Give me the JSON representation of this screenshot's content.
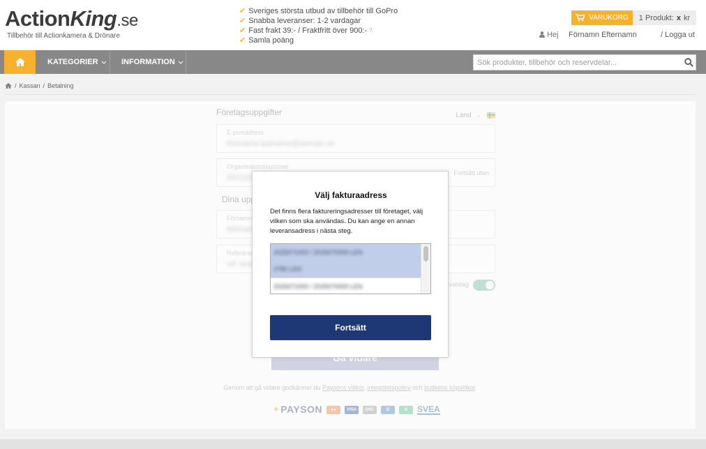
{
  "header": {
    "logo_action": "Action",
    "logo_king": "King",
    "logo_se": ".se",
    "logo_tagline": "Tillbehör till Actionkamera & Drönare",
    "usps": [
      "Sveriges största utbud av tillbehör till GoPro",
      "Snabba leveranser: 1-2 vardagar",
      "Fast frakt 39:- / Fraktfritt över 900:-",
      "Samla poäng"
    ],
    "usp_info": "?",
    "cart_label": "VARUKORG",
    "cart_count": "1 Produkt:",
    "cart_x": "x",
    "cart_currency": "kr",
    "greeting": "Hej",
    "user_name": "Förnamn Efternamn",
    "logout": "/ Logga ut"
  },
  "nav": {
    "items": [
      {
        "label": "KATEGORIER"
      },
      {
        "label": "INFORMATION"
      }
    ],
    "search_placeholder": "Sök produkter, tillbehör och reservdelar..."
  },
  "breadcrumb": {
    "items": [
      "Kassan",
      "Betalning"
    ]
  },
  "form": {
    "company_section": "Företagsuppgifter",
    "land_label": "Land",
    "email_label": "E-postadress",
    "email_value": "firstname.lastname@domain.se",
    "orgnr_label": "Organisationsnummer",
    "orgnr_value": "20211000000",
    "orgnr_side": "Fortsätt utan",
    "your_section": "Dina uppgifter",
    "firstname_label": "Förnamn",
    "firstname_value": "Michael",
    "reference_label": "Referens",
    "reference_value": "ref. text",
    "toggle_label": "Förvalstag",
    "continue_ghost": "Gå vidare",
    "terms_prefix": "Genom att gå vidare godkänner du ",
    "terms_link1": "Paysons villkor",
    "terms_sep": ", ",
    "terms_link2": "integritetspolicy",
    "terms_mid": " och ",
    "terms_link3": "butikens köpvillkor",
    "terms_end": ".",
    "payson": "PAYSON",
    "svea": "SVEA"
  },
  "modal": {
    "title": "Välj fakturaadress",
    "text": "Det finns flera faktureringsadresser till företaget, välj vilken som ska användas. Du kan ange en annan leveransadress i nästa steg.",
    "options": [
      "2025071000 / 2025070000 LEN",
      "0780 LEN",
      "2025071000 / 2025070000 LEN"
    ],
    "continue_label": "Fortsätt"
  },
  "colors": {
    "accent": "#f5a200",
    "nav_bg": "#6e6e6e",
    "primary_button": "#1e3876",
    "selected_option": "#c1ceea"
  }
}
